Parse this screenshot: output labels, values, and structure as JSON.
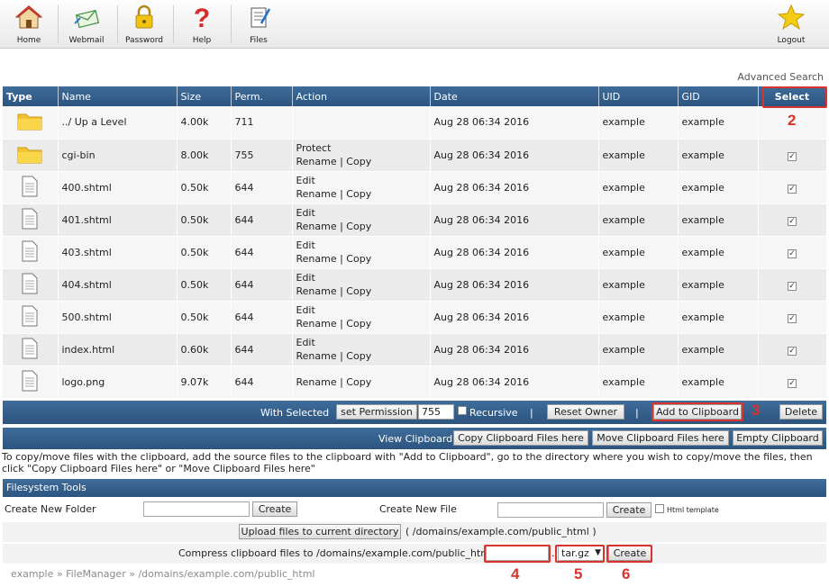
{
  "toolbar": {
    "items": [
      {
        "label": "Home",
        "icon": "house-icon"
      },
      {
        "label": "Webmail",
        "icon": "mail-icon"
      },
      {
        "label": "Password",
        "icon": "lock-icon"
      },
      {
        "label": "Help",
        "icon": "question-icon"
      },
      {
        "label": "Files",
        "icon": "files-icon"
      }
    ],
    "logout": {
      "label": "Logout",
      "icon": "star-icon"
    }
  },
  "advanced_search": "Advanced Search",
  "table": {
    "headers": [
      "Type",
      "Name",
      "Size",
      "Perm.",
      "Action",
      "Date",
      "UID",
      "GID",
      "Select"
    ],
    "rows": [
      {
        "type": "folder",
        "name": "../ Up a Level",
        "size": "4.00k",
        "perm": "711",
        "action1": "",
        "action2": "",
        "date": "Aug 28 06:34 2016",
        "uid": "example",
        "gid": "example",
        "checkbox": false
      },
      {
        "type": "folder",
        "name": "cgi-bin",
        "size": "8.00k",
        "perm": "755",
        "action1": "Protect",
        "action2": "Rename | Copy",
        "date": "Aug 28 06:34 2016",
        "uid": "example",
        "gid": "example",
        "checkbox": true
      },
      {
        "type": "file",
        "name": "400.shtml",
        "size": "0.50k",
        "perm": "644",
        "action1": "Edit",
        "action2": "Rename | Copy",
        "date": "Aug 28 06:34 2016",
        "uid": "example",
        "gid": "example",
        "checkbox": true
      },
      {
        "type": "file",
        "name": "401.shtml",
        "size": "0.50k",
        "perm": "644",
        "action1": "Edit",
        "action2": "Rename | Copy",
        "date": "Aug 28 06:34 2016",
        "uid": "example",
        "gid": "example",
        "checkbox": true
      },
      {
        "type": "file",
        "name": "403.shtml",
        "size": "0.50k",
        "perm": "644",
        "action1": "Edit",
        "action2": "Rename | Copy",
        "date": "Aug 28 06:34 2016",
        "uid": "example",
        "gid": "example",
        "checkbox": true
      },
      {
        "type": "file",
        "name": "404.shtml",
        "size": "0.50k",
        "perm": "644",
        "action1": "Edit",
        "action2": "Rename | Copy",
        "date": "Aug 28 06:34 2016",
        "uid": "example",
        "gid": "example",
        "checkbox": true
      },
      {
        "type": "file",
        "name": "500.shtml",
        "size": "0.50k",
        "perm": "644",
        "action1": "Edit",
        "action2": "Rename | Copy",
        "date": "Aug 28 06:34 2016",
        "uid": "example",
        "gid": "example",
        "checkbox": true
      },
      {
        "type": "file",
        "name": "index.html",
        "size": "0.60k",
        "perm": "644",
        "action1": "Edit",
        "action2": "Rename | Copy",
        "date": "Aug 28 06:34 2016",
        "uid": "example",
        "gid": "example",
        "checkbox": true
      },
      {
        "type": "file",
        "name": "logo.png",
        "size": "9.07k",
        "perm": "644",
        "action1": "",
        "action2": "Rename | Copy",
        "date": "Aug 28 06:34 2016",
        "uid": "example",
        "gid": "example",
        "checkbox": true
      }
    ]
  },
  "with_selected": {
    "label": "With Selected",
    "set_permission": "set Permission",
    "permission_value": "755",
    "recursive": "Recursive",
    "separator": "|",
    "reset_owner": "Reset Owner",
    "add_to_clipboard": "Add to Clipboard",
    "delete": "Delete"
  },
  "clipboard": {
    "view": "View Clipboard",
    "copy_here": "Copy Clipboard Files here",
    "move_here": "Move Clipboard Files here",
    "empty": "Empty Clipboard"
  },
  "help_text": "To copy/move files with the clipboard, add the source files to the clipboard with \"Add to Clipboard\", go to the directory where you wish to copy/move the files, then click \"Copy Clipboard Files here\" or \"Move Clipboard Files here\"",
  "filesystem_tools": {
    "title": "Filesystem Tools",
    "create_folder_label": "Create New Folder",
    "create_folder_value": "",
    "create_button": "Create",
    "create_file_label": "Create New File",
    "create_file_value": "",
    "html_template": "Html template",
    "upload_button": "Upload files to current directory",
    "upload_path": "( /domains/example.com/public_html )",
    "compress_label": "Compress clipboard files to /domains/example.com/public_html/",
    "compress_value": "",
    "compress_dot": ".",
    "format": "tar.gz",
    "format_arrow": "▼",
    "compress_create": "Create"
  },
  "breadcrumb": {
    "parts": [
      "example",
      "FileManager",
      "/domains/example.com/public_html"
    ],
    "separator": "»"
  },
  "annotations": [
    "2",
    "3",
    "4",
    "5",
    "6"
  ],
  "colors": {
    "header_blue": "#2c5580",
    "annotation_red": "#d8332e",
    "folder_yellow": "#f4c430"
  }
}
